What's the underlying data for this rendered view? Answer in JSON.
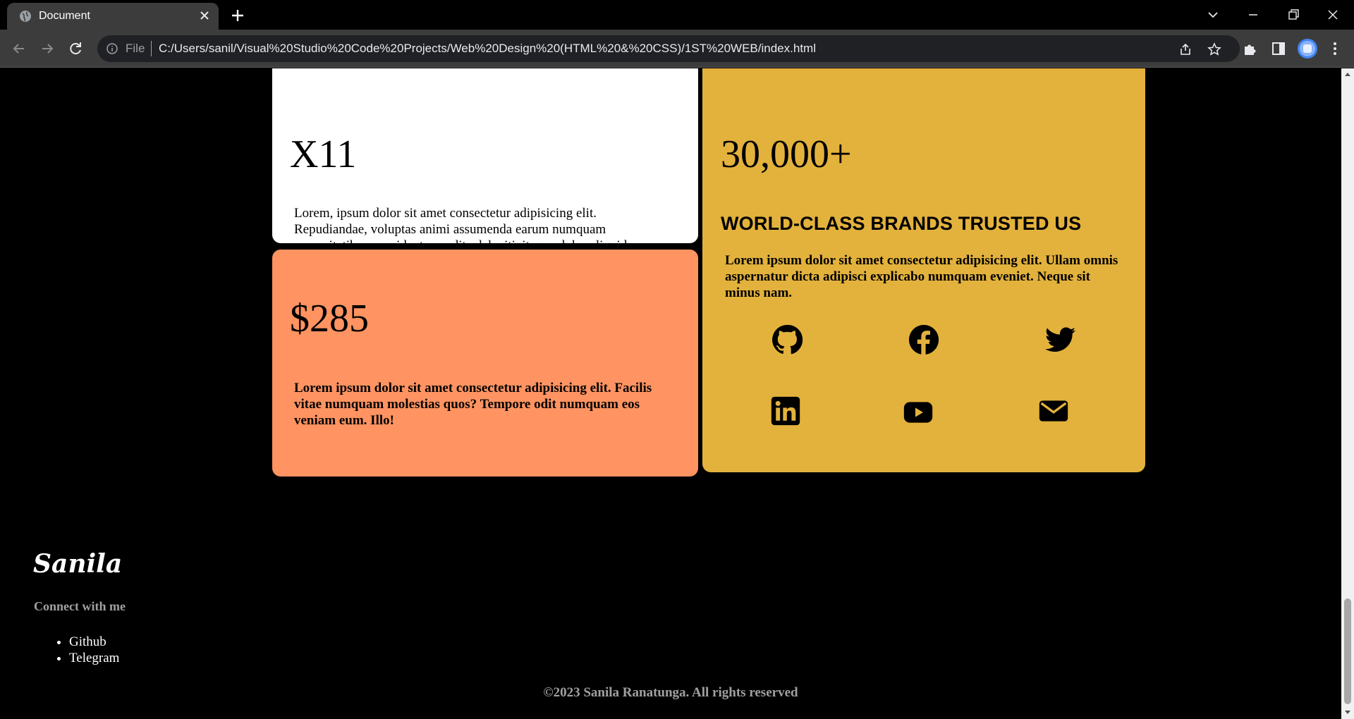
{
  "browser": {
    "tab_title": "Document",
    "scheme_label": "File",
    "url": "C:/Users/sanil/Visual%20Studio%20Code%20Projects/Web%20Design%20(HTML%20&%20CSS)/1ST%20WEB/index.html"
  },
  "cards": {
    "white": {
      "number": "X11",
      "text": "Lorem, ipsum dolor sit amet consectetur adipisicing elit. Repudiandae, voluptas animi assumenda earum numquam necessitatibus provident expedita deleniti, itaque dolor aliquid recusandae inventore perferendis est!"
    },
    "orange": {
      "number": "$285",
      "text": "Lorem ipsum dolor sit amet consectetur adipisicing elit. Facilis vitae numquam molestias quos? Tempore odit numquam eos veniam eum. Illo!"
    },
    "yellow": {
      "number": "30,000+",
      "heading": "WORLD-CLASS BRANDS TRUSTED US",
      "text": "Lorem ipsum dolor sit amet consectetur adipisicing elit. Ullam omnis aspernatur dicta adipisci explicabo numquam eveniet. Neque sit minus nam.",
      "social_icons": [
        "github-icon",
        "facebook-icon",
        "twitter-icon",
        "linkedin-icon",
        "youtube-icon",
        "envelope-icon"
      ]
    }
  },
  "footer": {
    "logo": "Sanila",
    "connect_label": "Connect with me",
    "links": [
      "Github",
      "Telegram"
    ],
    "copyright": "©2023 Sanila Ranatunga. All rights reserved"
  },
  "colors": {
    "page_bg": "#000000",
    "card_white": "#ffffff",
    "card_orange": "#ff9361",
    "card_yellow": "#e3b23c",
    "muted_text": "#a0a0a0"
  }
}
